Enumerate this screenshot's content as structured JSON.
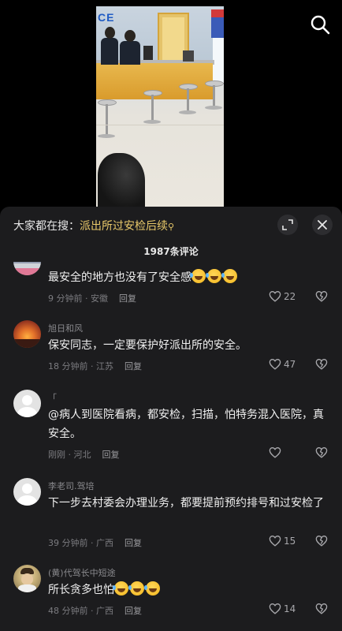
{
  "video": {
    "sign_text": "CE"
  },
  "header": {
    "hot_search_prefix": "大家都在搜：",
    "hot_search_keyword": "派出所过安检后续",
    "comment_count": "1987条评论"
  },
  "icons": {
    "search": "search-icon",
    "expand": "expand-icon",
    "close": "close-icon",
    "like": "heart-icon",
    "dislike": "broken-heart-icon",
    "laugh_emoji": "laughing-tears-emoji"
  },
  "colors": {
    "sheet_bg": "#1c1c1e",
    "keyword": "#e9c96a"
  },
  "comments": [
    {
      "username": "",
      "text": "最安全的地方也没有了安全感",
      "time_location": "9 分钟前 · 安徽",
      "reply": "回复",
      "likes": "22"
    },
    {
      "username": "旭日和风",
      "text": "保安同志，一定要保护好派出所的安全。",
      "time_location": "18 分钟前 · 江苏",
      "reply": "回复",
      "likes": "47"
    },
    {
      "username": "「",
      "text": "@病人到医院看病，都安检，扫描，怕特务混入医院，真安全。",
      "time_location": "刚刚 · 河北",
      "reply": "回复",
      "likes": ""
    },
    {
      "username": "李老司.驾培",
      "text": "下一步去村委会办理业务，都要提前预约排号和过安检了",
      "time_location": "39 分钟前 · 广西",
      "reply": "回复",
      "likes": "15"
    },
    {
      "username": "(黄)代驾长中短途",
      "text": "所长贪多也怕",
      "time_location": "48 分钟前 · 广西",
      "reply": "回复",
      "likes": "14"
    }
  ]
}
